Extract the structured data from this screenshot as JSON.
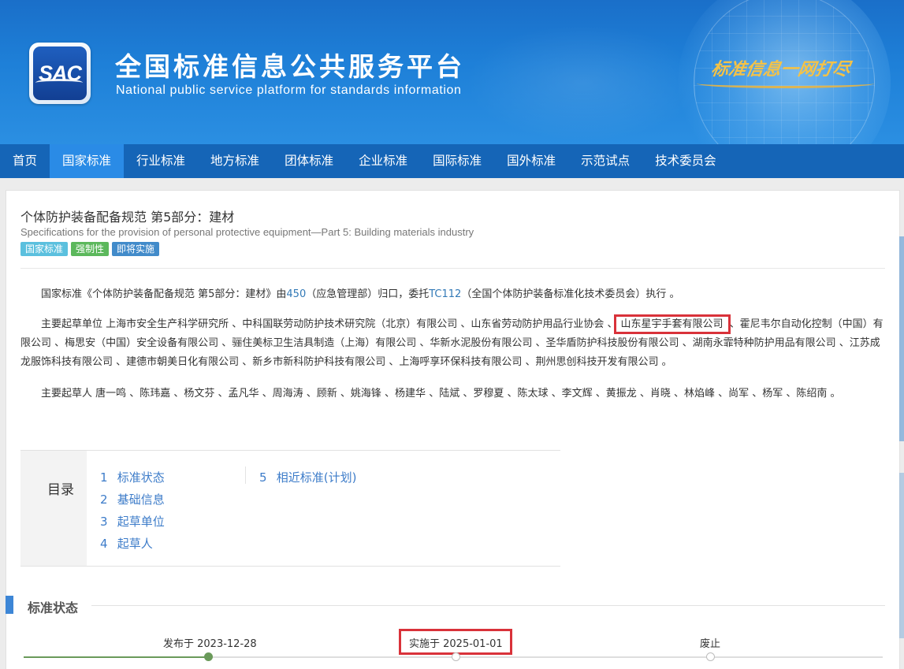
{
  "header": {
    "logo_text": "SAC",
    "title": "全国标准信息公共服务平台",
    "subtitle": "National public service platform  for standards information",
    "slogan": "标准信息一网打尽"
  },
  "nav": {
    "items": [
      "首页",
      "国家标准",
      "行业标准",
      "地方标准",
      "团体标准",
      "企业标准",
      "国际标准",
      "国外标准",
      "示范试点",
      "技术委员会"
    ],
    "active_index": 1
  },
  "standard": {
    "title": "个体防护装备配备规范 第5部分：建材",
    "title_en": "Specifications for the provision of personal protective equipment—Part 5: Building materials industry",
    "tags": [
      "国家标准",
      "强制性",
      "即将实施"
    ]
  },
  "intro": {
    "p1_prefix": "国家标准《个体防护装备配备规范 第5部分：建材》由",
    "p1_link1": "450",
    "p1_mid": "（应急管理部）归口，委托",
    "p1_link2": "TC112",
    "p1_suffix": "（全国个体防护装备标准化技术委员会）执行 。",
    "p2_prefix": "主要起草单位 上海市安全生产科学研究所 、中科国联劳动防护技术研究院（北京）有限公司 、山东省劳动防护用品行业协会 、",
    "p2_highlight": "山东星宇手套有限公司",
    "p2_suffix": " 、霍尼韦尔自动化控制（中国）有限公司 、梅思安（中国）安全设备有限公司 、骊住美标卫生洁具制造（上海）有限公司 、华新水泥股份有限公司 、圣华盾防护科技股份有限公司 、湖南永霏特种防护用品有限公司 、江苏成龙服饰科技有限公司 、建德市朝美日化有限公司 、新乡市新科防护科技有限公司 、上海呼享环保科技有限公司 、荆州思创科技开发有限公司 。",
    "p3": "主要起草人 唐一鸣 、陈玮嘉 、杨文芬 、孟凡华 、周海涛 、顾新 、姚海锋 、杨建华 、陆斌 、罗穆夏 、陈太球 、李文辉 、黄振龙 、肖晓 、林焰峰 、尚军 、杨军 、陈绍南 。"
  },
  "toc": {
    "label": "目录",
    "col1": [
      {
        "num": "1",
        "text": "标准状态"
      },
      {
        "num": "2",
        "text": "基础信息"
      },
      {
        "num": "3",
        "text": "起草单位"
      },
      {
        "num": "4",
        "text": "起草人"
      }
    ],
    "col2": [
      {
        "num": "5",
        "text": "相近标准(计划)"
      }
    ]
  },
  "status_section": {
    "title": "标准状态",
    "timeline": [
      {
        "label": "发布于 2023-12-28",
        "state": "done"
      },
      {
        "label": "实施于 2025-01-01",
        "state": "pending"
      },
      {
        "label": "废止",
        "state": "pending"
      }
    ],
    "progress_fraction": 0.215
  },
  "colors": {
    "nav_bg": "#1565b7",
    "nav_active": "#2a8be6",
    "link": "#337ab7",
    "highlight_box": "#d9323a",
    "timeline_done": "#6a9a5a"
  }
}
